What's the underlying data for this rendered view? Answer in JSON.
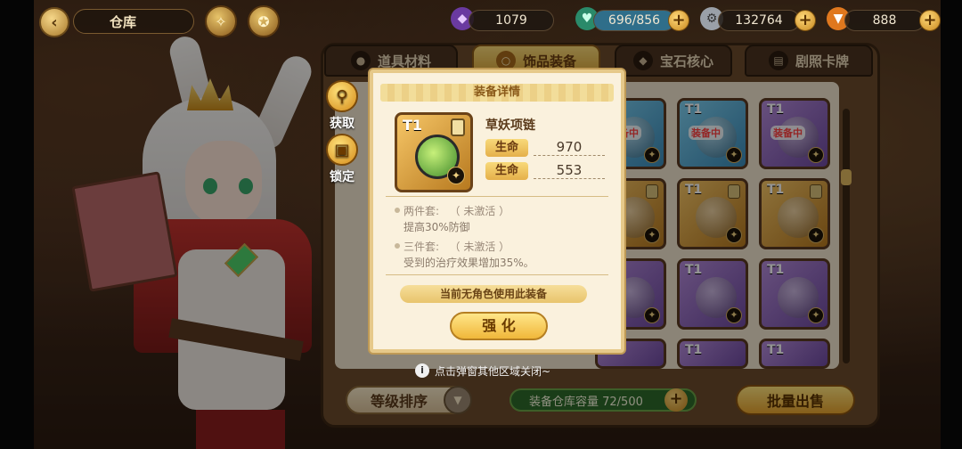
{
  "header": {
    "title": "仓库",
    "resources": [
      {
        "icon": "purple-crystal-icon",
        "value": "1079"
      },
      {
        "icon": "potion-icon",
        "value": "696/856"
      },
      {
        "icon": "coin-icon",
        "value": "132764"
      },
      {
        "icon": "carrot-icon",
        "value": "888"
      }
    ]
  },
  "tabs": [
    {
      "label": "道具材料",
      "active": false
    },
    {
      "label": "饰品装备",
      "active": true
    },
    {
      "label": "宝石核心",
      "active": false
    },
    {
      "label": "剧照卡牌",
      "active": false
    }
  ],
  "side_actions": {
    "obtain": "获取",
    "lock": "锁定"
  },
  "grid": {
    "equipped_label": "装备中",
    "tier": "T1"
  },
  "bottom": {
    "sort_label": "等级排序",
    "capacity_label": "装备仓库容量 72/500",
    "sell_label": "批量出售"
  },
  "hint": "点击弹窗其他区域关闭~",
  "modal": {
    "title": "装备详情",
    "item": {
      "tier": "T1",
      "name": "草妖项链",
      "stats": [
        {
          "label": "生命",
          "value": "970"
        },
        {
          "label": "生命",
          "value": "553"
        }
      ]
    },
    "sets": [
      {
        "title": "两件套:",
        "status": "（ 未激活 ）",
        "desc": "提高30%防御"
      },
      {
        "title": "三件套:",
        "status": "（ 未激活 ）",
        "desc": "受到的治疗效果增加35%。"
      }
    ],
    "note": "当前无角色使用此装备",
    "enhance_label": "强 化"
  },
  "colors": {
    "frame": "#6b4b2c",
    "accent_gold": "#f0b73a",
    "capacity_green": "#2d6a2a",
    "modal_bg": "#faf1dd"
  }
}
